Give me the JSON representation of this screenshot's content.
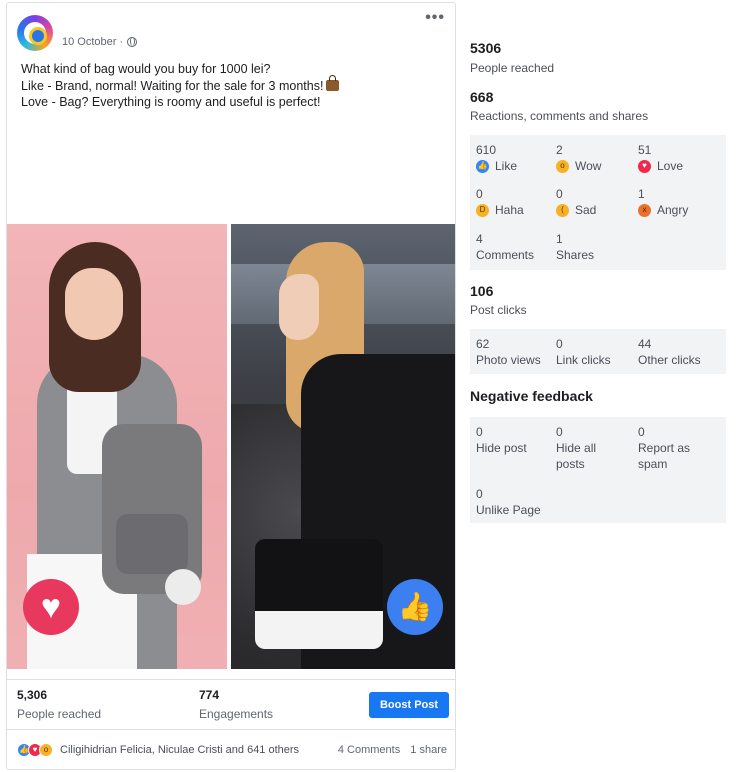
{
  "post": {
    "date": "10 October ·",
    "more": "•••",
    "text_lines": [
      "What kind of bag would you buy for 1000 lei?",
      "Like - Brand, normal! Waiting for the sale for 3 months!",
      "Love - Bag? Everything is roomy and useful is perfect!"
    ],
    "stats": {
      "reached_value": "5,306",
      "reached_label": "People reached",
      "engagements_value": "774",
      "engagements_label": "Engagements"
    },
    "boost_label": "Boost Post",
    "reactors_text": "Ciligihidrian Felicia, Niculae Cristi and 641 others",
    "comments_count": "4 Comments",
    "shares_count": "1 share",
    "icons": {
      "love": "heart-icon",
      "like": "thumbs-up-icon"
    }
  },
  "insights": {
    "people_reached": {
      "value": "5306",
      "label": "People reached"
    },
    "reactions_total": {
      "value": "668",
      "label": "Reactions, comments and shares"
    },
    "reactions": [
      {
        "count": "610",
        "label": "Like",
        "icon": "like-icon"
      },
      {
        "count": "2",
        "label": "Wow",
        "icon": "wow-icon"
      },
      {
        "count": "51",
        "label": "Love",
        "icon": "love-icon"
      },
      {
        "count": "0",
        "label": "Haha",
        "icon": "haha-icon"
      },
      {
        "count": "0",
        "label": "Sad",
        "icon": "sad-icon"
      },
      {
        "count": "1",
        "label": "Angry",
        "icon": "angry-icon"
      }
    ],
    "comments": {
      "count": "4",
      "label": "Comments"
    },
    "shares": {
      "count": "1",
      "label": "Shares"
    },
    "post_clicks": {
      "value": "106",
      "label": "Post clicks"
    },
    "clicks": [
      {
        "count": "62",
        "label": "Photo views"
      },
      {
        "count": "0",
        "label": "Link clicks"
      },
      {
        "count": "44",
        "label": "Other clicks"
      }
    ],
    "negative_title": "Negative feedback",
    "negative": [
      {
        "count": "0",
        "label": "Hide post"
      },
      {
        "count": "0",
        "label": "Hide all posts"
      },
      {
        "count": "0",
        "label": "Report as spam"
      },
      {
        "count": "0",
        "label": "Unlike Page"
      }
    ]
  }
}
